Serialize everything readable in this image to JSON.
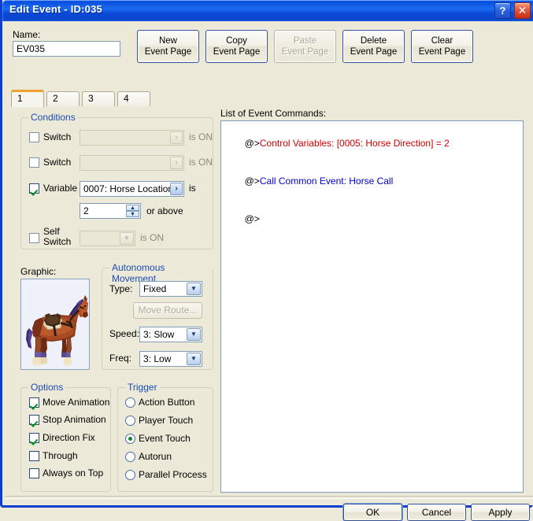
{
  "window": {
    "title": "Edit Event - ID:035",
    "help_button": "?",
    "close_button": "✕"
  },
  "name_field": {
    "label": "Name:",
    "value": "EV035",
    "placeholder": ""
  },
  "page_buttons": [
    {
      "line1": "New",
      "line2": "Event Page",
      "disabled": false
    },
    {
      "line1": "Copy",
      "line2": "Event Page",
      "disabled": false
    },
    {
      "line1": "Paste",
      "line2": "Event Page",
      "disabled": true
    },
    {
      "line1": "Delete",
      "line2": "Event Page",
      "disabled": false
    },
    {
      "line1": "Clear",
      "line2": "Event Page",
      "disabled": false
    }
  ],
  "tabs": {
    "active_index": 0,
    "items": [
      {
        "label": "1"
      },
      {
        "label": "2"
      },
      {
        "label": "3"
      },
      {
        "label": "4"
      }
    ]
  },
  "conditions": {
    "title": "Conditions",
    "switch1": {
      "label": "Switch",
      "checked": false,
      "value": "",
      "suffix": "is ON",
      "button_glyph": "›"
    },
    "switch2": {
      "label": "Switch",
      "checked": false,
      "value": "",
      "suffix": "is ON",
      "button_glyph": "›"
    },
    "variable": {
      "label": "Variable",
      "checked": true,
      "value": "0007: Horse Location",
      "suffix": "is",
      "button_glyph": "›",
      "amount": "2",
      "amount_suffix": "or above",
      "spinner_up": "▲",
      "spinner_down": "▼"
    },
    "self_switch": {
      "label_line1": "Self",
      "label_line2": "Switch",
      "checked": false,
      "value": "",
      "suffix": "is ON",
      "button_glyph": "▼"
    }
  },
  "graphic": {
    "label": "Graphic:",
    "sprite_name": "horse-sprite"
  },
  "autonomous_movement": {
    "title": "Autonomous Movement",
    "type_label": "Type:",
    "type_value": "Fixed",
    "move_route_button": "Move Route...",
    "speed_label": "Speed:",
    "speed_value": "3: Slow",
    "freq_label": "Freq:",
    "freq_value": "3: Low",
    "dropdown_glyph": "▼"
  },
  "options": {
    "title": "Options",
    "items": [
      {
        "label": "Move Animation",
        "checked": true
      },
      {
        "label": "Stop Animation",
        "checked": true
      },
      {
        "label": "Direction Fix",
        "checked": true
      },
      {
        "label": "Through",
        "checked": false
      },
      {
        "label": "Always on Top",
        "checked": false
      }
    ]
  },
  "trigger": {
    "title": "Trigger",
    "selected_index": 2,
    "items": [
      {
        "label": "Action Button"
      },
      {
        "label": "Player Touch"
      },
      {
        "label": "Event Touch"
      },
      {
        "label": "Autorun"
      },
      {
        "label": "Parallel Process"
      }
    ]
  },
  "event_commands": {
    "label": "List of Event Commands:",
    "lines": [
      {
        "prefix": "@>",
        "text": "Control Variables: [0005: Horse Direction] = 2",
        "color": "red"
      },
      {
        "prefix": "@>",
        "text": "Call Common Event: Horse Call",
        "color": "blue"
      },
      {
        "prefix": "@>",
        "text": "",
        "color": "none"
      }
    ]
  },
  "footer": {
    "ok": "OK",
    "cancel": "Cancel",
    "apply": "Apply"
  },
  "colors": {
    "titlebar": "#0a4fe0",
    "group_title": "#1b4db3",
    "dialog_bg": "#ece9d8",
    "active_tab_accent": "#f0a030",
    "command_red": "#cf0000",
    "command_blue": "#0000d0",
    "check_green": "#0c8a2b"
  }
}
